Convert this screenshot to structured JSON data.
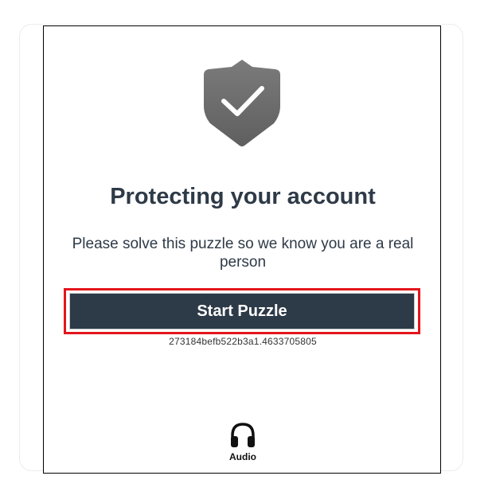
{
  "challenge": {
    "title": "Protecting your account",
    "message": "Please solve this puzzle so we know you are a real person",
    "start_label": "Start Puzzle",
    "session_id": "273184befb522b3a1.4633705805",
    "audio_label": "Audio"
  },
  "icons": {
    "shield": "shield-check-icon",
    "audio": "headphones-icon"
  },
  "colors": {
    "title_text": "#2e3a47",
    "button_bg": "#2d3a48",
    "highlight": "#e3161c",
    "shield": "#6f6f6f"
  }
}
